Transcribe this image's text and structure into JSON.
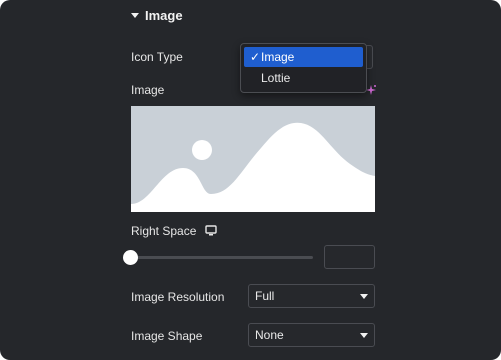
{
  "section": {
    "title": "Image"
  },
  "icon_type": {
    "label": "Icon Type",
    "options": [
      "Image",
      "Lottie"
    ],
    "selected": "Image"
  },
  "image": {
    "label": "Image"
  },
  "right_space": {
    "label": "Right Space",
    "value": "",
    "slider_fraction": 0
  },
  "image_resolution": {
    "label": "Image Resolution",
    "value": "Full"
  },
  "image_shape": {
    "label": "Image Shape",
    "value": "None"
  },
  "colors": {
    "panel_bg": "#25272b",
    "accent": "#1f5ecf",
    "placeholder_bg": "#c9d0d7",
    "placeholder_shape": "#ffffff",
    "ai_icon": "#d16ad6"
  },
  "icons": [
    "caret-down-icon",
    "check-icon",
    "ai-sparkle-icon",
    "desktop-icon",
    "chevron-down-icon"
  ]
}
